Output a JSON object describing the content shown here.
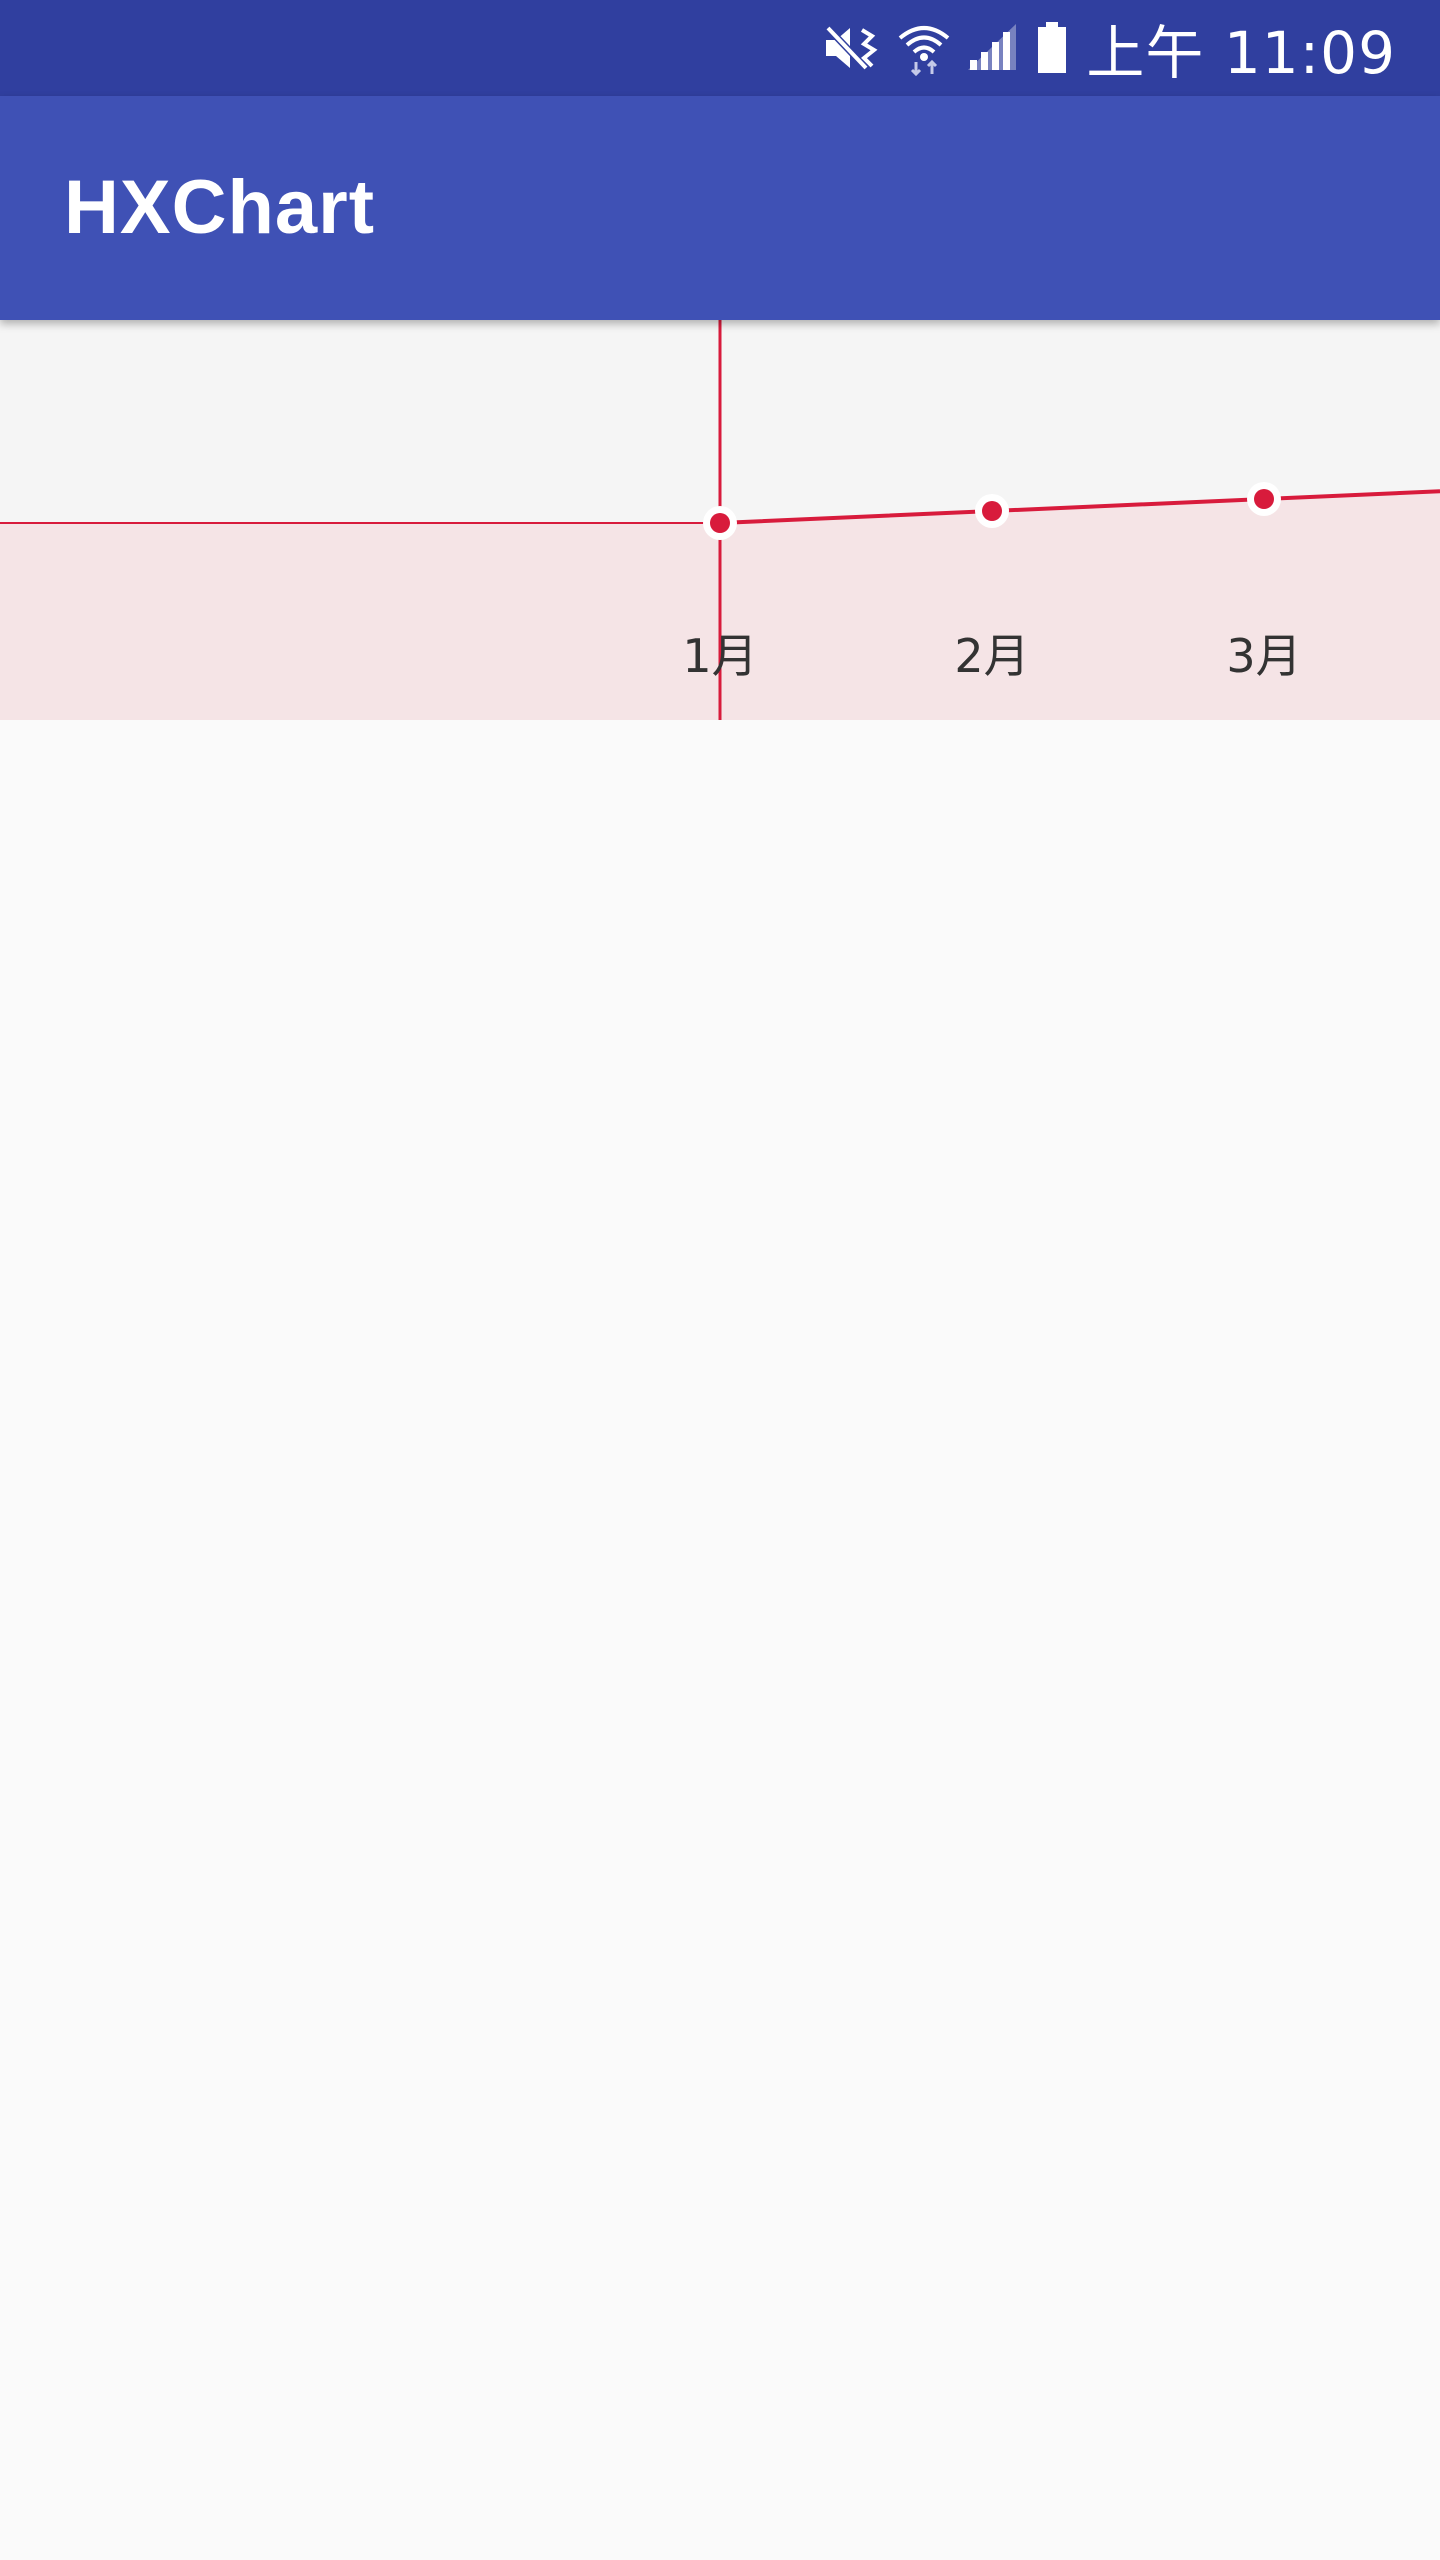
{
  "status_bar": {
    "time": "上午 11:09",
    "icons": [
      "mute-icon",
      "wifi-icon",
      "signal-icon",
      "battery-icon"
    ]
  },
  "app_bar": {
    "title": "HXChart"
  },
  "colors": {
    "status_bar": "#303f9f",
    "app_bar": "#3f51b5",
    "line": "#d81b3c",
    "fill": "#f5e4e6",
    "chart_bg": "#f5f5f5",
    "page_bg": "#fafafa"
  },
  "chart_data": {
    "type": "area",
    "categories": [
      "1月",
      "2月",
      "3月"
    ],
    "series": [
      {
        "values": [
          10,
          10.5,
          11
        ]
      }
    ],
    "selected_category": "1月",
    "grid": false,
    "legend": "none"
  }
}
